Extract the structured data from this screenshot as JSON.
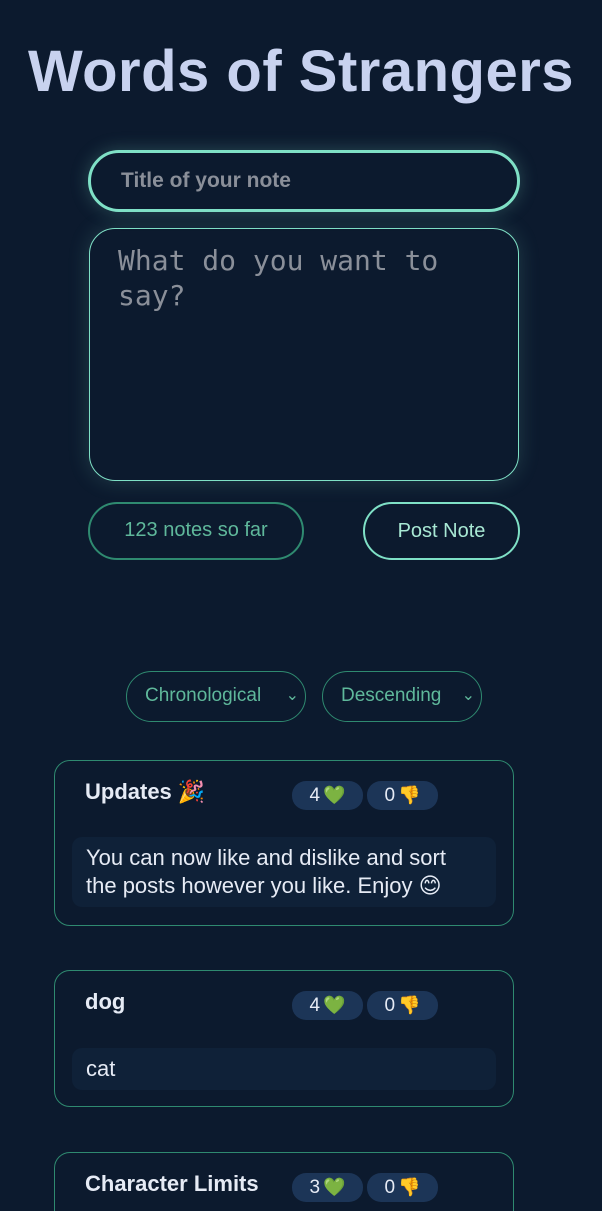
{
  "header": {
    "title": "Words of Strangers"
  },
  "composer": {
    "title_placeholder": "Title of your note",
    "body_placeholder": "What do you want to say?",
    "count_label": "123 notes so far",
    "post_label": "Post Note"
  },
  "sort": {
    "order_value": "Chronological",
    "direction_value": "Descending"
  },
  "notes": [
    {
      "title": "Updates 🎉",
      "likes": "4",
      "like_emoji": "💚",
      "dislikes": "0",
      "dislike_emoji": "👎",
      "body": "You can now like and dislike and sort the posts however you like. Enjoy 😊"
    },
    {
      "title": "dog",
      "likes": "4",
      "like_emoji": "💚",
      "dislikes": "0",
      "dislike_emoji": "👎",
      "body": "cat"
    },
    {
      "title": "Character Limits",
      "likes": "3",
      "like_emoji": "💚",
      "dislikes": "0",
      "dislike_emoji": "👎",
      "body": ""
    }
  ],
  "colors": {
    "background": "#0c1a2e",
    "accent": "#7fe0c6",
    "accent_dim": "#2f8a70",
    "title": "#c8d2ef",
    "pill": "#1c3557"
  }
}
